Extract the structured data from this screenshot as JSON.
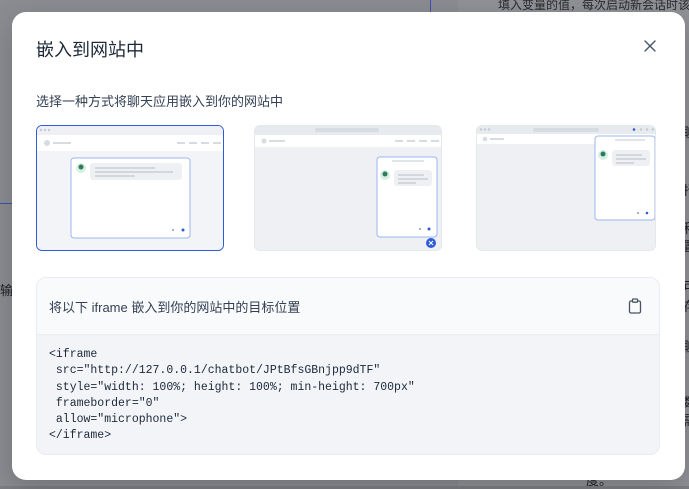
{
  "background": {
    "top_text": "填入变量的值，每次启动新会话时该",
    "side_chars": [
      "聊",
      "抒",
      "和",
      "置",
      "可",
      "存",
      "聊",
      "数",
      "需",
      "度。",
      "输"
    ]
  },
  "modal": {
    "title": "嵌入到网站中",
    "close_icon": "close-icon",
    "subtitle": "选择一种方式将聊天应用嵌入到你的网站中",
    "options": [
      {
        "name": "fullpage",
        "selected": true
      },
      {
        "name": "floating-bubble",
        "selected": false
      },
      {
        "name": "chrome-extension",
        "selected": false
      }
    ],
    "code": {
      "header": "将以下 iframe 嵌入到你的网站中的目标位置",
      "copy_icon": "clipboard-icon",
      "lines": [
        "<iframe",
        " src=\"http://127.0.0.1/chatbot/JPtBfsGBnjpp9dTF\"",
        " style=\"width: 100%; height: 100%; min-height: 700px\"",
        " frameborder=\"0\"",
        " allow=\"microphone\">",
        "</iframe>"
      ]
    }
  },
  "colors": {
    "accent": "#2e5bd9",
    "overlay": "#8a8c91"
  }
}
